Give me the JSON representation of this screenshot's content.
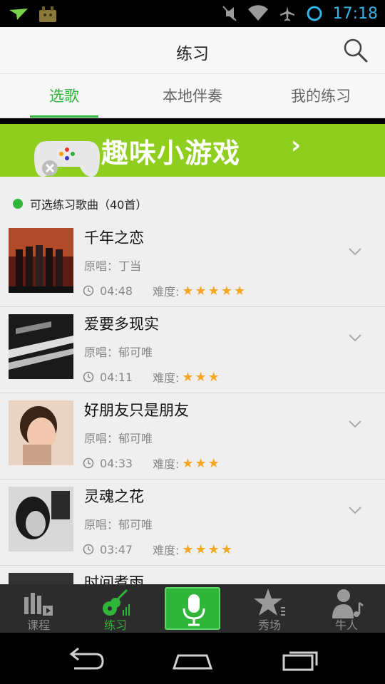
{
  "status_bar": {
    "time": "17:18",
    "icons": [
      "send-notification-icon",
      "android-app-icon",
      "mute-icon",
      "wifi-icon",
      "airplane-mode-icon",
      "sync-icon"
    ]
  },
  "header": {
    "title": "练习",
    "search_icon": "search-icon"
  },
  "tabs": [
    {
      "label": "选歌",
      "active": true
    },
    {
      "label": "本地伴奏",
      "active": false
    },
    {
      "label": "我的练习",
      "active": false
    }
  ],
  "banner": {
    "text": "趣味小游戏",
    "chevron": "›",
    "icon": "gamepad-icon",
    "bg_color": "#8fcd1f"
  },
  "section": {
    "title": "可选练习歌曲（40首）"
  },
  "song_labels": {
    "difficulty": "难度:"
  },
  "songs": [
    {
      "name": "千年之恋",
      "artist": "原唱：丁当",
      "duration": "04:48",
      "stars": "★★★★★",
      "rating": 5
    },
    {
      "name": "爱要多现实",
      "artist": "原唱：郁可唯",
      "duration": "04:11",
      "stars": "★★★",
      "rating": 3
    },
    {
      "name": "好朋友只是朋友",
      "artist": "原唱：郁可唯",
      "duration": "04:33",
      "stars": "★★★",
      "rating": 3
    },
    {
      "name": "灵魂之花",
      "artist": "原唱：郁可唯",
      "duration": "03:47",
      "stars": "★★★★",
      "rating": 4
    },
    {
      "name": "时间煮雨",
      "artist": "",
      "duration": "",
      "stars": "",
      "rating": 0
    }
  ],
  "bottom_nav": [
    {
      "label": "课程",
      "icon": "course-icon",
      "active": false
    },
    {
      "label": "练习",
      "icon": "guitar-icon",
      "active": true
    },
    {
      "label": "",
      "icon": "microphone-icon",
      "active": false
    },
    {
      "label": "秀场",
      "icon": "star-show-icon",
      "active": false
    },
    {
      "label": "牛人",
      "icon": "person-music-icon",
      "active": false
    }
  ],
  "colors": {
    "accent": "#2fb53a",
    "star": "#f5a623",
    "status_time": "#33b5e5"
  }
}
